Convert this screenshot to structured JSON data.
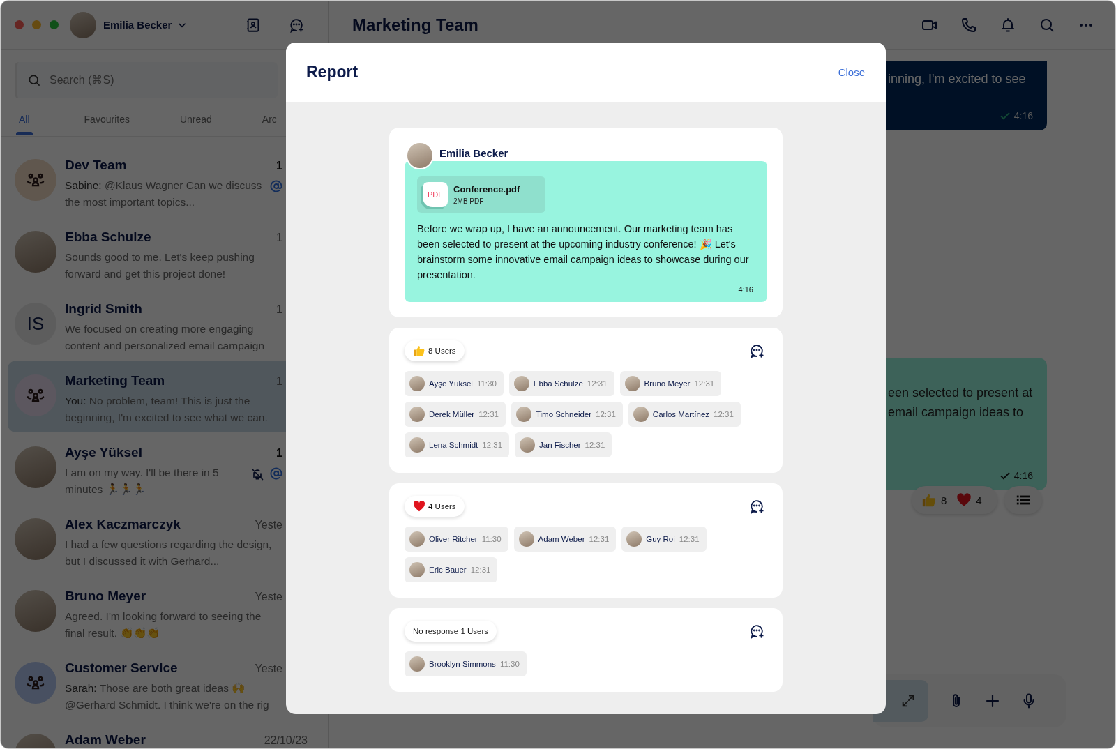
{
  "account": {
    "name": "Emilia Becker"
  },
  "search": {
    "placeholder": "Search (⌘S)"
  },
  "filter_tabs": [
    {
      "label": "All",
      "selected": true
    },
    {
      "label": "Favourites",
      "selected": false
    },
    {
      "label": "Unread",
      "selected": false
    },
    {
      "label": "Arc",
      "selected": false
    }
  ],
  "conversations": [
    {
      "name": "Dev Team",
      "preview": "**Sabine:** @Klaus Wagner Can we discuss the most important topics...",
      "time": "1",
      "unread": true,
      "muted": false,
      "mentioned": true,
      "selected": false,
      "avatar": {
        "kind": "group"
      }
    },
    {
      "name": "Ebba Schulze",
      "preview": "Sounds good to me. Let's keep pushing forward and get this project done!",
      "time": "1",
      "unread": false,
      "muted": false,
      "mentioned": false,
      "selected": false,
      "avatar": {
        "kind": "photo"
      }
    },
    {
      "name": "Ingrid Smith",
      "preview": "We focused on creating more engaging content and personalized email campaign",
      "time": "1",
      "unread": false,
      "muted": false,
      "mentioned": false,
      "selected": false,
      "avatar": {
        "kind": "initials",
        "initials": "IS"
      }
    },
    {
      "name": "Marketing Team",
      "preview": "**You:** No problem, team! This is just the beginning, I'm excited to see what we can.",
      "time": "1",
      "unread": false,
      "muted": false,
      "mentioned": false,
      "selected": true,
      "avatar": {
        "kind": "group"
      }
    },
    {
      "name": "Ayşe Yüksel",
      "preview": "I am on my way. I'll be there in 5 minutes 🏃🏃🏃",
      "time": "1",
      "unread": true,
      "muted": true,
      "mentioned": true,
      "selected": false,
      "avatar": {
        "kind": "photo"
      }
    },
    {
      "name": "Alex Kaczmarczyk",
      "preview": "I had a few questions regarding the design, but I discussed it with Gerhard...",
      "time": "Yeste",
      "unread": false,
      "muted": false,
      "mentioned": false,
      "selected": false,
      "avatar": {
        "kind": "photo"
      }
    },
    {
      "name": "Bruno Meyer",
      "preview": "Agreed. I'm looking forward to seeing the final result. 👏👏👏",
      "time": "Yeste",
      "unread": false,
      "muted": false,
      "mentioned": false,
      "selected": false,
      "avatar": {
        "kind": "photo"
      }
    },
    {
      "name": "Customer Service",
      "preview": "**Sarah:** Those are both great ideas 🙌 @Gerhard Schmidt. I think we're on the rig",
      "time": "Yeste",
      "unread": false,
      "muted": false,
      "mentioned": false,
      "selected": false,
      "avatar": {
        "kind": "group"
      }
    },
    {
      "name": "Adam Weber",
      "time": "22/10/23",
      "unread": false,
      "muted": false,
      "mentioned": false,
      "selected": false,
      "avatar": {
        "kind": "photo"
      }
    }
  ],
  "chat": {
    "title": "Marketing Team",
    "messages": [
      {
        "kind": "outgoing",
        "lines": [
          "inning, I'm excited to see"
        ],
        "time": "4:16"
      },
      {
        "kind": "announcement",
        "lines": [
          "een selected to present at",
          "email campaign ideas to"
        ],
        "time": "4:16",
        "reactions": [
          {
            "kind": "thumbs",
            "count": "8"
          },
          {
            "kind": "heart",
            "count": "4"
          }
        ]
      }
    ]
  },
  "report": {
    "title": "Report",
    "close_label": "Close",
    "message": {
      "sender": "Emilia Becker",
      "attachment": {
        "name": "Conference.pdf",
        "meta": "2MB PDF",
        "type_label": "PDF"
      },
      "text": "Before we wrap up, I have an announcement. Our marketing team has been selected to present at the upcoming industry conference! 🎉 Let's brainstorm some innovative email campaign ideas to showcase during our presentation.",
      "time": "4:16"
    },
    "reaction_groups": [
      {
        "kind": "thumbs",
        "label": "8 Users",
        "users": [
          {
            "name": "Ayşe Yüksel",
            "time": "11:30"
          },
          {
            "name": "Ebba Schulze",
            "time": "12:31"
          },
          {
            "name": "Bruno Meyer",
            "time": "12:31"
          },
          {
            "name": "Derek Müller",
            "time": "12:31"
          },
          {
            "name": "Timo Schneider",
            "time": "12:31"
          },
          {
            "name": "Carlos Martínez",
            "time": "12:31"
          },
          {
            "name": "Lena Schmidt",
            "time": "12:31"
          },
          {
            "name": "Jan Fischer",
            "time": "12:31"
          }
        ]
      },
      {
        "kind": "heart",
        "label": "4 Users",
        "users": [
          {
            "name": "Oliver Ritcher",
            "time": "11:30"
          },
          {
            "name": "Adam Weber",
            "time": "12:31"
          },
          {
            "name": "Guy Roi",
            "time": "12:31"
          },
          {
            "name": "Eric Bauer",
            "time": "12:31"
          }
        ]
      },
      {
        "kind": "none",
        "label": "No response 1 Users",
        "users": [
          {
            "name": "Brooklyn Simmons",
            "time": "11:30"
          }
        ]
      }
    ]
  }
}
